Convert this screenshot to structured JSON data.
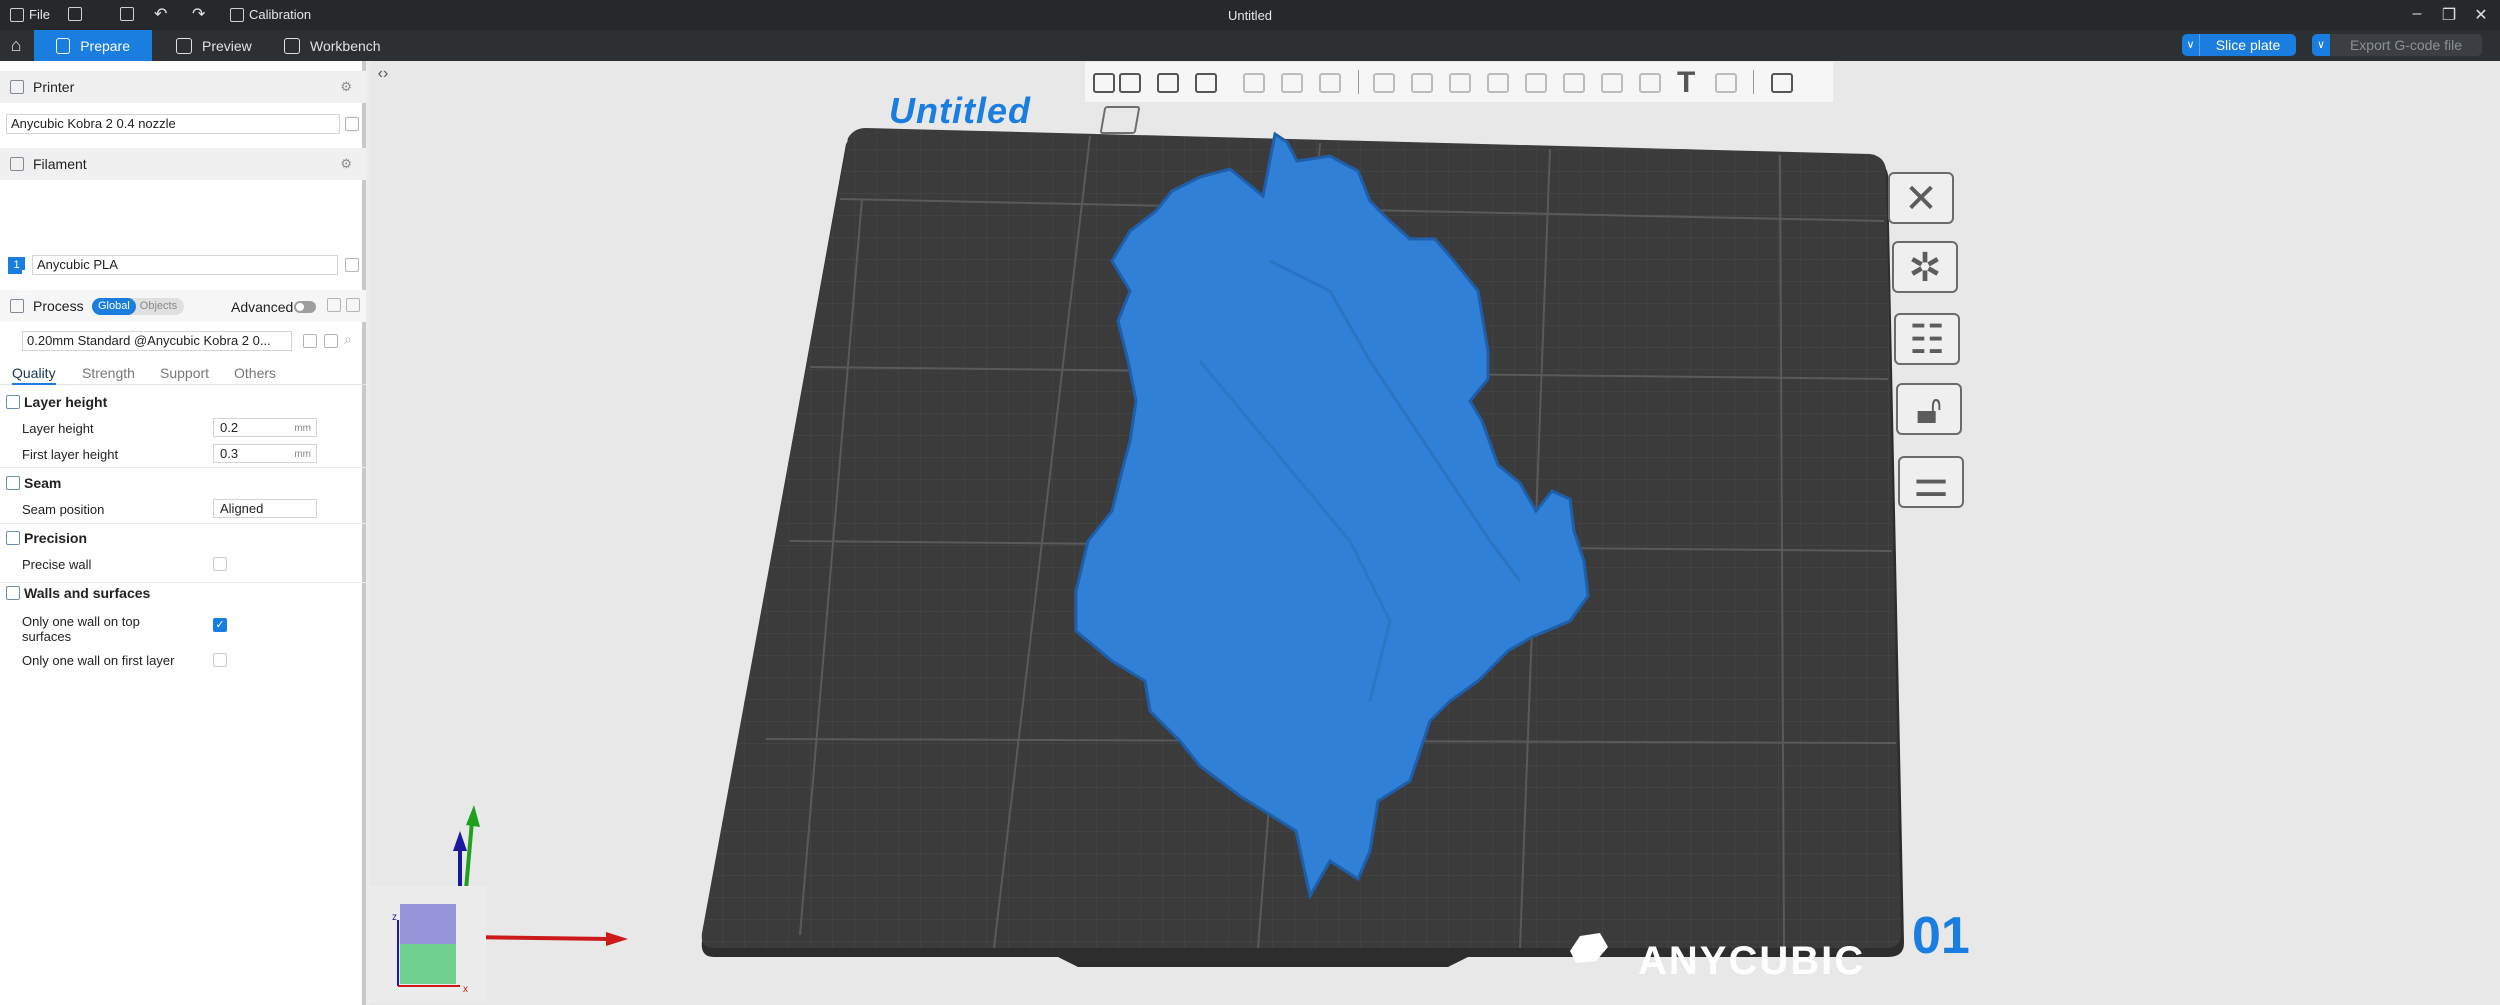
{
  "titlebar": {
    "title": "Untitled",
    "file_label": "File",
    "calibration_label": "Calibration"
  },
  "tabs": {
    "prepare": "Prepare",
    "preview": "Preview",
    "workbench": "Workbench"
  },
  "actions": {
    "slice_plate": "Slice plate",
    "export_gcode": "Export G-code file"
  },
  "printer": {
    "section_label": "Printer",
    "selected": "Anycubic Kobra 2 0.4 nozzle"
  },
  "filament": {
    "section_label": "Filament",
    "slot_number": "1",
    "selected": "Anycubic PLA"
  },
  "process": {
    "section_label": "Process",
    "global_label": "Global",
    "objects_label": "Objects",
    "advanced_label": "Advanced",
    "preset": "0.20mm Standard @Anycubic Kobra 2 0..."
  },
  "subtabs": [
    "Quality",
    "Strength",
    "Support",
    "Others"
  ],
  "settings": {
    "layer_height_group": "Layer height",
    "layer_height_label": "Layer height",
    "layer_height_value": "0.2",
    "first_layer_height_label": "First layer height",
    "first_layer_height_value": "0.3",
    "unit": "mm",
    "seam_group": "Seam",
    "seam_position_label": "Seam position",
    "seam_position_value": "Aligned",
    "precision_group": "Precision",
    "precise_wall_label": "Precise wall",
    "walls_group": "Walls and surfaces",
    "one_wall_top_label_1": "Only one wall on top",
    "one_wall_top_label_2": "surfaces",
    "one_wall_first_label": "Only one wall on first layer"
  },
  "viewport": {
    "plate_name": "Untitled",
    "plate_number": "01",
    "brand": "ANYCUBIC",
    "model_color": "#2f80d6",
    "bed_color": "#3a3a3a"
  }
}
